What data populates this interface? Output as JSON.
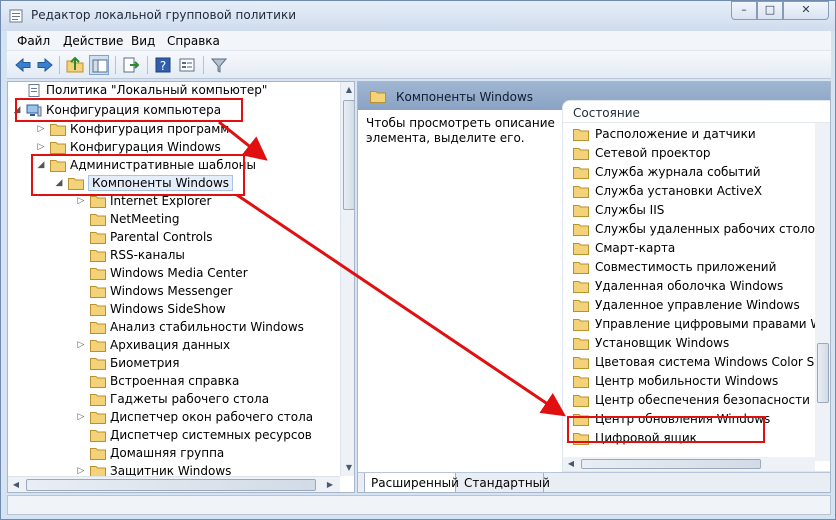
{
  "window": {
    "title": "Редактор локальной групповой политики",
    "minimize_glyph": "–",
    "maximize_glyph": "□",
    "close_glyph": "✕"
  },
  "menu": [
    "Файл",
    "Действие",
    "Вид",
    "Справка"
  ],
  "toolbar": {
    "icons": [
      "back-arrow-icon",
      "forward-arrow-icon",
      "folder-up-icon",
      "show-hide-tree-icon",
      "export-list-icon",
      "help-icon",
      "properties-icon",
      "filter-icon"
    ]
  },
  "tree": {
    "root": "Политика \"Локальный компьютер\"",
    "computer_config": "Конфигурация компьютера",
    "software_settings": "Конфигурация программ",
    "windows_settings": "Конфигурация Windows",
    "admin_templates": "Административные шаблоны",
    "windows_components": "Компоненты Windows",
    "children": [
      "Internet Explorer",
      "NetMeeting",
      "Parental Controls",
      "RSS-каналы",
      "Windows Media Center",
      "Windows Messenger",
      "Windows SideShow",
      "Анализ стабильности Windows",
      "Архивация данных",
      "Биометрия",
      "Встроенная справка",
      "Гаджеты рабочего стола",
      "Диспетчер окон рабочего стола",
      "Диспетчер системных ресурсов",
      "Домашняя группа",
      "Защитник Windows"
    ],
    "expand_glyph": "▷",
    "expanded_glyph": "◢"
  },
  "right": {
    "header": "Компоненты Windows",
    "description": "Чтобы просмотреть описание элемента, выделите его.",
    "column_header": "Состояние",
    "items": [
      "Расположение и датчики",
      "Сетевой проектор",
      "Служба журнала событий",
      "Служба установки ActiveX",
      "Службы IIS",
      "Службы удаленных рабочих столов",
      "Смарт-карта",
      "Совместимость приложений",
      "Удаленная оболочка Windows",
      "Удаленное управление Windows",
      "Управление цифровыми правами Windows",
      "Установщик Windows",
      "Цветовая система Windows Color System",
      "Центр мобильности Windows",
      "Центр обеспечения безопасности",
      "Центр обновления Windows",
      "Цифровой ящик"
    ],
    "tabs": [
      "Расширенный",
      "Стандартный"
    ]
  },
  "colors": {
    "highlight": "#e01010",
    "folder": "#f3d27a",
    "header": "#8aa3c3"
  }
}
